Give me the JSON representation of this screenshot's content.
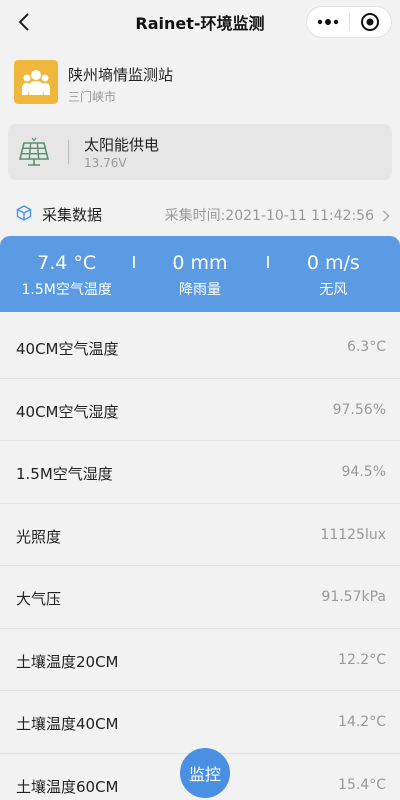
{
  "header": {
    "title": "Rainet-环境监测",
    "more_icon": "more-dots-icon",
    "close_icon": "target-circle-icon"
  },
  "station": {
    "name": "陕州墒情监测站",
    "city": "三门峡市",
    "icon": "group-people-icon"
  },
  "power": {
    "label": "太阳能供电",
    "voltage": "13.76V",
    "icon": "solar-panel-icon"
  },
  "collection": {
    "label": "采集数据",
    "time": "采集时间:2021-10-11 11:42:56",
    "icon": "cube-icon"
  },
  "summary": [
    {
      "value": "7.4 °C",
      "label": "1.5M空气温度"
    },
    {
      "value": "0 mm",
      "label": "降雨量"
    },
    {
      "value": "0 m/s",
      "label": "无风"
    }
  ],
  "readings": [
    {
      "label": "40CM空气温度",
      "value": "6.3°C"
    },
    {
      "label": "40CM空气湿度",
      "value": "97.56%"
    },
    {
      "label": "1.5M空气湿度",
      "value": "94.5%"
    },
    {
      "label": "光照度",
      "value": "11125lux"
    },
    {
      "label": "大气压",
      "value": "91.57kPa"
    },
    {
      "label": "土壤温度20CM",
      "value": "12.2°C"
    },
    {
      "label": "土壤温度40CM",
      "value": "14.2°C"
    },
    {
      "label": "土壤温度60CM",
      "value": "15.4°C"
    }
  ],
  "fab": {
    "label": "监控"
  },
  "colors": {
    "accent": "#5b9be3",
    "station_logo": "#f0b73d",
    "fab": "#4a90e2"
  }
}
